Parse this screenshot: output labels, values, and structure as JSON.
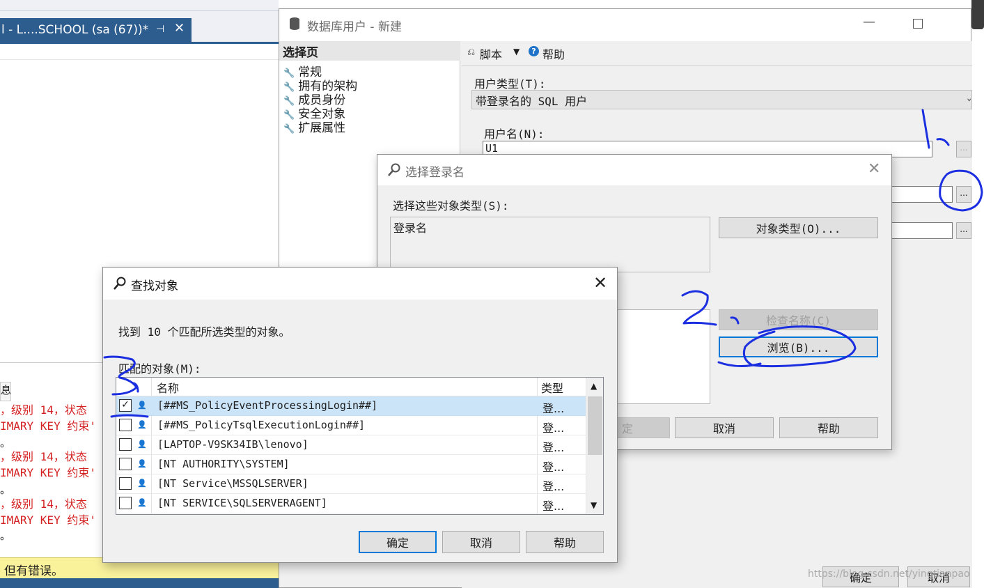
{
  "ssms": {
    "tab_title": "l - L....SCHOOL (sa (67))*",
    "tab_pin": "⊣",
    "tab_close": "✕",
    "results_tab": "息",
    "messages": [
      {
        "text": "，级别 14，状态"
      },
      {
        "text": "IMARY KEY 约束'"
      },
      {
        "text": "。"
      },
      {
        "text": "，级别 14，状态"
      },
      {
        "text": "IMARY KEY 约束'"
      },
      {
        "text": "。"
      },
      {
        "text": "，级别 14，状态"
      },
      {
        "text": "IMARY KEY 约束'"
      },
      {
        "text": "。"
      }
    ],
    "status_text": "但有错误。"
  },
  "db_user_dialog": {
    "title": "数据库用户 - 新建",
    "pages_header": "选择页",
    "pages": [
      "常规",
      "拥有的架构",
      "成员身份",
      "安全对象",
      "扩展属性"
    ],
    "toolbar": {
      "script": "脚本",
      "help": "帮助"
    },
    "user_type_label": "用户类型(T):",
    "user_type_value": "带登录名的 SQL 用户",
    "user_name_label": "用户名(N):",
    "user_name_value": "U1",
    "browse_dots": "...",
    "ok": "确定",
    "cancel": "取消"
  },
  "select_login_dialog": {
    "title": "选择登录名",
    "object_types_label": "选择这些对象类型(S):",
    "object_types_value": "登录名",
    "object_types_button": "对象类型(O)...",
    "check_names_button": "检查名称(C)",
    "browse_button": "浏览(B)...",
    "ok_partial": "定",
    "cancel": "取消",
    "help": "帮助"
  },
  "find_objects_dialog": {
    "title": "查找对象",
    "summary": "找到 10 个匹配所选类型的对象。",
    "matches_label": "匹配的对象(M):",
    "columns": {
      "name": "名称",
      "type": "类型"
    },
    "rows": [
      {
        "name": "[##MS_PolicyEventProcessingLogin##]",
        "type": "登...",
        "checked": "✓"
      },
      {
        "name": "[##MS_PolicyTsqlExecutionLogin##]",
        "type": "登...",
        "checked": ""
      },
      {
        "name": "[LAPTOP-V9SK34IB\\lenovo]",
        "type": "登...",
        "checked": ""
      },
      {
        "name": "[NT AUTHORITY\\SYSTEM]",
        "type": "登...",
        "checked": ""
      },
      {
        "name": "[NT Service\\MSSQLSERVER]",
        "type": "登...",
        "checked": ""
      },
      {
        "name": "[NT SERVICE\\SQLSERVERAGENT]",
        "type": "登...",
        "checked": ""
      }
    ],
    "ok": "确定",
    "cancel": "取消",
    "help": "帮助"
  },
  "watermark": "https://blog.csdn.net/yingtianpao",
  "colors": {
    "ink": "#1b2fe0",
    "selection": "#cce4f7",
    "accent": "#0078d7",
    "status_bar": "#faf29b",
    "error_text": "#d42020"
  },
  "icons": [
    "database-icon",
    "search-icon",
    "wrench-icon",
    "help-icon",
    "script-icon",
    "user-icon",
    "close-icon"
  ]
}
